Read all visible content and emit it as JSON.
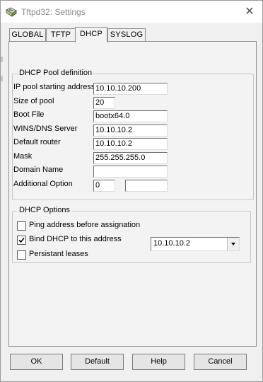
{
  "window": {
    "title": "Tftpd32: Settings",
    "close_glyph": "✕"
  },
  "tabs": [
    {
      "label": "GLOBAL",
      "active": false
    },
    {
      "label": "TFTP",
      "active": false
    },
    {
      "label": "DHCP",
      "active": true
    },
    {
      "label": "SYSLOG",
      "active": false
    }
  ],
  "pool": {
    "legend": "DHCP Pool definition",
    "ip_start": {
      "label": "IP pool starting address",
      "value": "10.10.10.200"
    },
    "pool_size": {
      "label": "Size of pool",
      "value": "20"
    },
    "boot_file": {
      "label": "Boot File",
      "value": "bootx64.0"
    },
    "wins_dns": {
      "label": "WINS/DNS Server",
      "value": "10.10.10.2"
    },
    "router": {
      "label": "Default router",
      "value": "10.10.10.2"
    },
    "mask": {
      "label": "Mask",
      "value": "255.255.255.0"
    },
    "domain": {
      "label": "Domain Name",
      "value": ""
    },
    "additional": {
      "label": "Additional Option",
      "number": "0",
      "value": ""
    }
  },
  "options": {
    "legend": "DHCP Options",
    "ping": {
      "label": "Ping address before assignation",
      "checked": false
    },
    "bind": {
      "label": "Bind DHCP to this address",
      "checked": true
    },
    "persistant": {
      "label": "Persistant leases",
      "checked": false
    },
    "bind_address": "10.10.10.2"
  },
  "buttons": {
    "ok": "OK",
    "default": "Default",
    "help": "Help",
    "cancel": "Cancel"
  }
}
